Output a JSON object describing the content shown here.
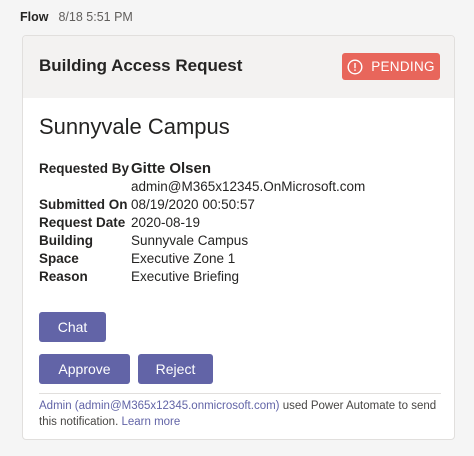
{
  "message": {
    "sender": "Flow",
    "time": "8/18 5:51 PM"
  },
  "card": {
    "title": "Building Access Request",
    "status": "PENDING",
    "status_icon": "alert-circle-icon",
    "status_color": "#e8665b",
    "campus": "Sunnyvale Campus",
    "requester": {
      "label": "Requested By",
      "name": "Gitte Olsen",
      "email": "admin@M365x12345.OnMicrosoft.com"
    },
    "facts": [
      {
        "label": "Submitted On",
        "value": "08/19/2020 00:50:57"
      },
      {
        "label": "Request Date",
        "value": "2020-08-19"
      },
      {
        "label": "Building",
        "value": "Sunnyvale Campus"
      },
      {
        "label": "Space",
        "value": "Executive Zone 1"
      },
      {
        "label": "Reason",
        "value": "Executive Briefing"
      }
    ],
    "buttons": {
      "chat": "Chat",
      "approve": "Approve",
      "reject": "Reject"
    },
    "accent_color": "#6264a7",
    "footer": {
      "admin_link": "Admin (admin@M365x12345.onmicrosoft.com)",
      "middle_text": " used Power Automate to send this notification. ",
      "learn_more": "Learn more"
    }
  }
}
